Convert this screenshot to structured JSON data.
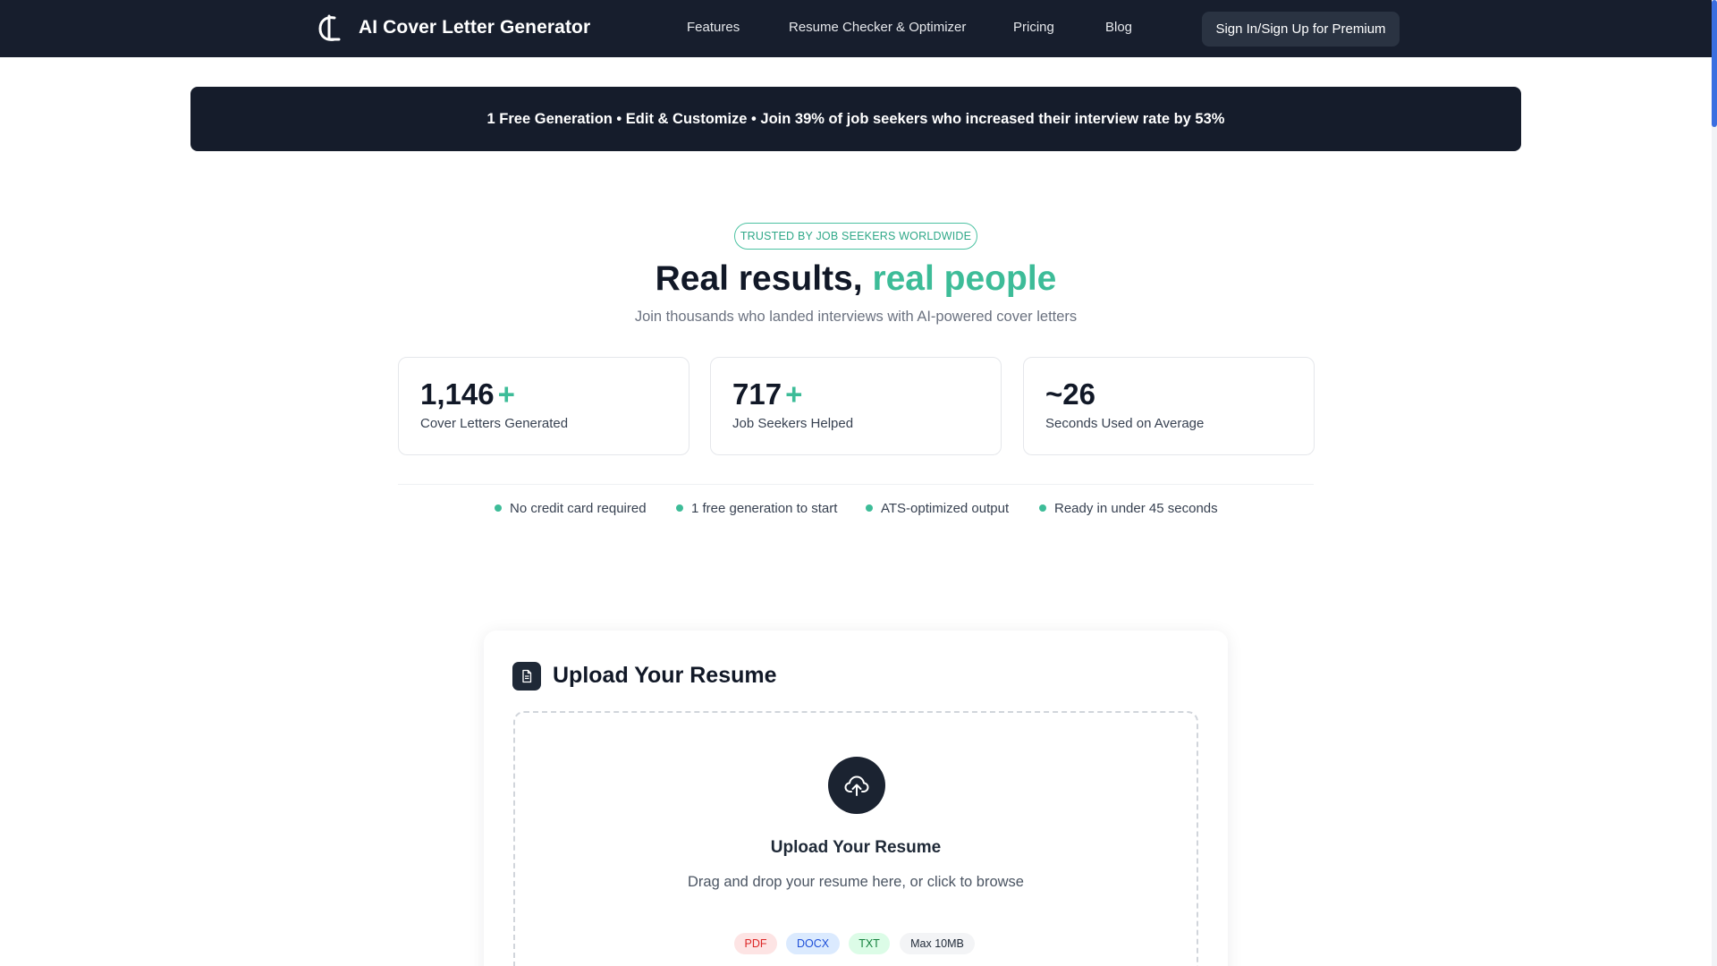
{
  "nav": {
    "brand": "AI Cover Letter Generator",
    "links": [
      "Features",
      "Resume Checker & Optimizer",
      "Pricing",
      "Blog"
    ],
    "cta": "Sign In/Sign Up for Premium"
  },
  "banner": {
    "text": "1 Free Generation • Edit & Customize • Join 39% of job seekers who increased their interview rate by 53%"
  },
  "hero": {
    "badge": "TRUSTED BY JOB SEEKERS WORLDWIDE",
    "headline_main": "Real results,",
    "headline_accent": "real people",
    "subheadline": "Join thousands who landed interviews with AI-powered cover letters"
  },
  "stats": [
    {
      "value": "1,146",
      "suffix": "+",
      "label": "Cover Letters Generated"
    },
    {
      "value": "717",
      "suffix": "+",
      "label": "Job Seekers Helped"
    },
    {
      "value": "~26",
      "suffix": "",
      "label": "Seconds Used on Average"
    }
  ],
  "features": [
    "No credit card required",
    "1 free generation to start",
    "ATS-optimized output",
    "Ready in under 45 seconds"
  ],
  "upload": {
    "title": "Upload Your Resume",
    "drop_title": "Upload Your Resume",
    "drop_subtitle": "Drag and drop your resume here, or click to browse",
    "formats": [
      "PDF",
      "DOCX",
      "TXT",
      "Max 10MB"
    ]
  },
  "colors": {
    "nav_bg": "#171e2d",
    "accent": "#3dbc98",
    "banner_bg": "#151c2b",
    "pdf_chip_bg": "#fde4e4",
    "pdf_chip_text": "#dc2626",
    "docx_chip_bg": "#dbeafe",
    "docx_chip_text": "#1d4ed8",
    "txt_chip_bg": "#dcfce7",
    "txt_chip_text": "#15803d",
    "size_chip_bg": "#f3f4f6",
    "size_chip_text": "#1f2937"
  },
  "icons": {
    "logo": "cl-monogram-logo",
    "upload_header": "document-icon",
    "dropzone": "cloud-upload-icon"
  }
}
